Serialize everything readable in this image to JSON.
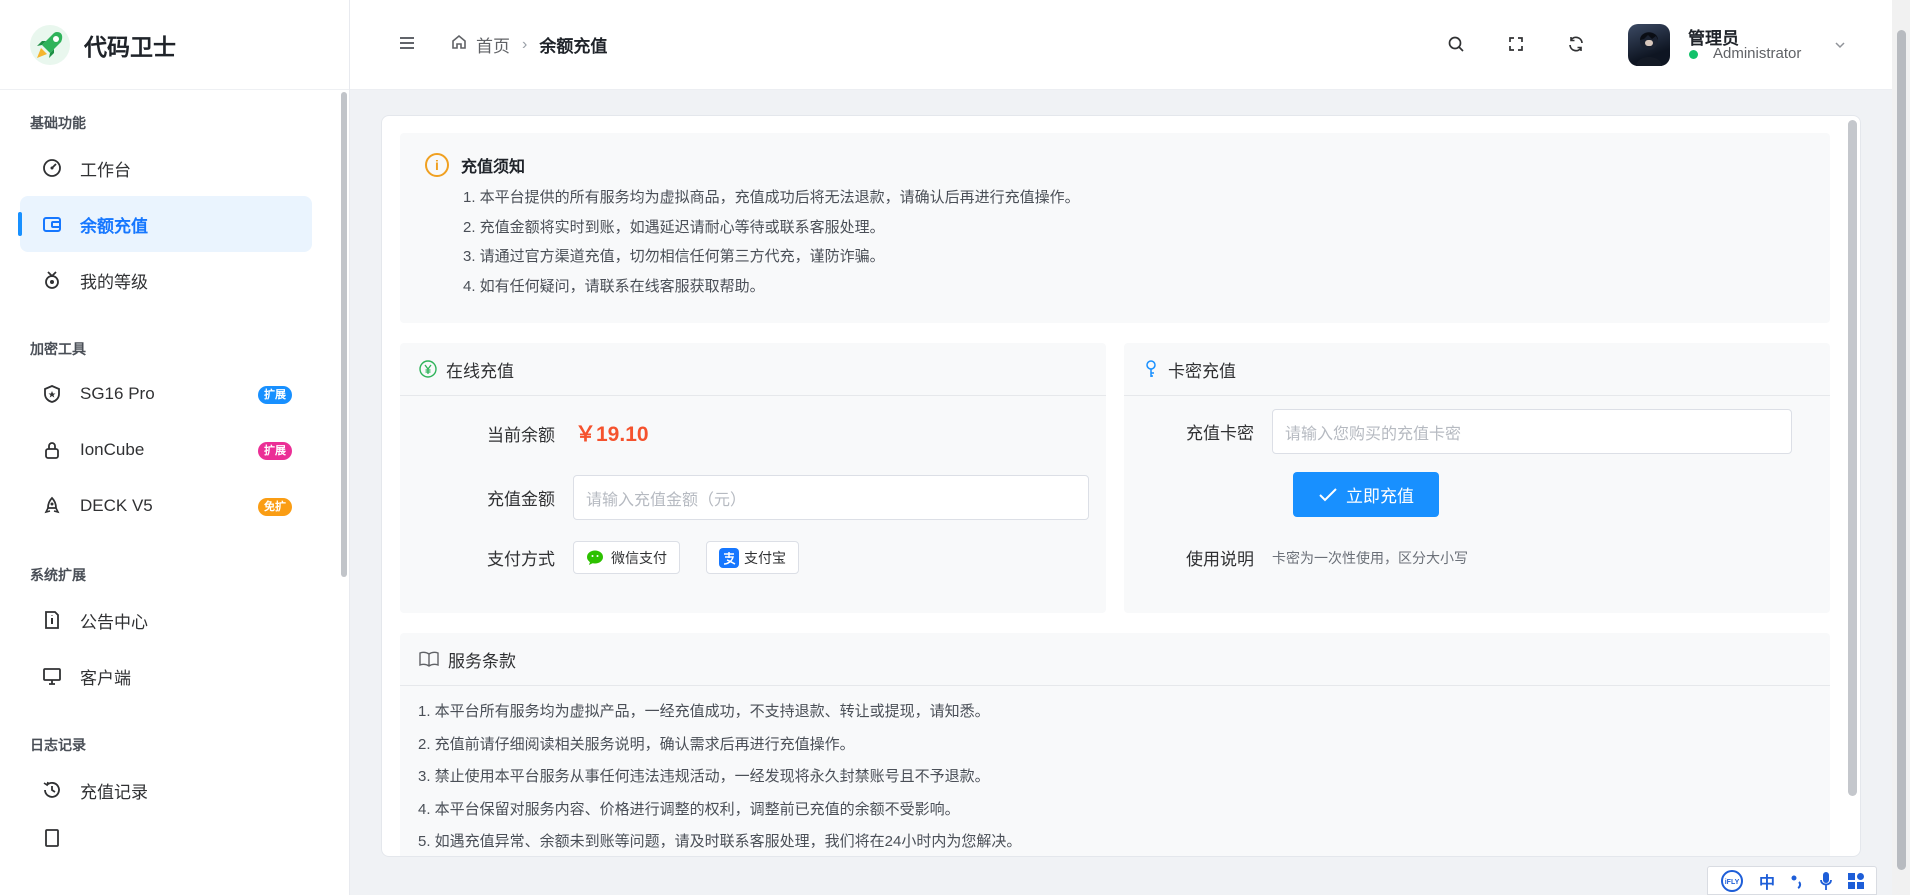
{
  "app": {
    "name": "代码卫士"
  },
  "sidebar": {
    "groups": [
      {
        "title": "基础功能",
        "items": [
          {
            "label": "工作台",
            "icon": "dashboard-icon"
          },
          {
            "label": "余额充值",
            "icon": "wallet-icon",
            "active": true
          },
          {
            "label": "我的等级",
            "icon": "medal-icon"
          }
        ]
      },
      {
        "title": "加密工具",
        "items": [
          {
            "label": "SG16 Pro",
            "icon": "shield-icon",
            "badge": "扩展",
            "badge_color": "#1890ff"
          },
          {
            "label": "IonCube",
            "icon": "lock-icon",
            "badge": "扩展",
            "badge_color": "#eb2f96"
          },
          {
            "label": "DECK V5",
            "icon": "rocket-icon",
            "badge": "免扩",
            "badge_color": "#fa9d14"
          }
        ]
      },
      {
        "title": "系统扩展",
        "items": [
          {
            "label": "公告中心",
            "icon": "notice-icon"
          },
          {
            "label": "客户端",
            "icon": "monitor-icon"
          }
        ]
      },
      {
        "title": "日志记录",
        "items": [
          {
            "label": "充值记录",
            "icon": "history-icon"
          }
        ]
      }
    ]
  },
  "header": {
    "breadcrumb_home": "首页",
    "breadcrumb_current": "余额充值",
    "user_name": "管理员",
    "user_role": "Administrator"
  },
  "notice": {
    "title": "充值须知",
    "items": [
      "1. 本平台提供的所有服务均为虚拟商品，充值成功后将无法退款，请确认后再进行充值操作。",
      "2. 充值金额将实时到账，如遇延迟请耐心等待或联系客服处理。",
      "3. 请通过官方渠道充值，切勿相信任何第三方代充，谨防诈骗。",
      "4. 如有任何疑问，请联系在线客服获取帮助。"
    ]
  },
  "online": {
    "title": "在线充值",
    "balance_label": "当前余额",
    "balance_value": "￥19.10",
    "amount_label": "充值金额",
    "amount_placeholder": "请输入充值金额（元）",
    "pay_label": "支付方式",
    "wechat": "微信支付",
    "alipay": "支付宝"
  },
  "card": {
    "title": "卡密充值",
    "code_label": "充值卡密",
    "code_placeholder": "请输入您购买的充值卡密",
    "submit": "立即充值",
    "usage_label": "使用说明",
    "usage_text": "卡密为一次性使用，区分大小写"
  },
  "terms": {
    "title": "服务条款",
    "items": [
      "1. 本平台所有服务均为虚拟产品，一经充值成功，不支持退款、转让或提现，请知悉。",
      "2. 充值前请仔细阅读相关服务说明，确认需求后再进行充值操作。",
      "3. 禁止使用本平台服务从事任何违法违规活动，一经发现将永久封禁账号且不予退款。",
      "4. 本平台保留对服务内容、价格进行调整的权利，调整前已充值的余额不受影响。",
      "5. 如遇充值异常、余额未到账等问题，请及时联系客服处理，我们将在24小时内为您解决。"
    ]
  },
  "ime": {
    "brand": "iFLY",
    "mode": "中"
  }
}
